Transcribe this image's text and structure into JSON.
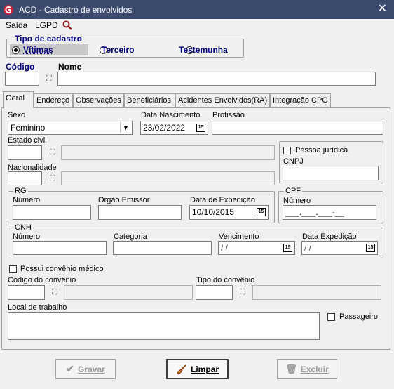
{
  "window": {
    "title": "ACD - Cadastro de envolvidos",
    "close_glyph": "✕"
  },
  "menu": {
    "items": [
      "Saída",
      "LGPD"
    ],
    "search_icon": "search-icon"
  },
  "tipo_cadastro": {
    "title": "Tipo de cadastro",
    "options": [
      "Vítimas",
      "Terceiro",
      "Testemunha"
    ],
    "selected": "Vítimas"
  },
  "header_fields": {
    "codigo_label": "Código",
    "codigo_value": "",
    "nome_label": "Nome",
    "nome_value": ""
  },
  "tabs": [
    "Geral",
    "Endereço",
    "Observações",
    "Beneficiários",
    "Acidentes Envolvidos(RA)",
    "Integração CPG"
  ],
  "active_tab": "Geral",
  "geral": {
    "sexo_label": "Sexo",
    "sexo_value": "Feminino",
    "nascimento_label": "Data Nascimento",
    "nascimento_value": "23/02/2022",
    "profissao_label": "Profissão",
    "profissao_value": "",
    "estado_civil_label": "Estado civil",
    "nacionalidade_label": "Nacionalidade",
    "pessoa_juridica_label": "Pessoa jurídica",
    "cnpj_label": "CNPJ",
    "cnpj_value": "",
    "rg": {
      "title": "RG",
      "numero_label": "Número",
      "numero_value": "",
      "orgao_label": "Orgão Emissor",
      "orgao_value": "",
      "expedicao_label": "Data de Expedição",
      "expedicao_value": "10/10/2015"
    },
    "cpf": {
      "title": "CPF",
      "numero_label": "Número",
      "numero_value": "___.___.___-__"
    },
    "cnh": {
      "title": "CNH",
      "numero_label": "Número",
      "categoria_label": "Categoria",
      "vencimento_label": "Vencimento",
      "vencimento_value": " / /",
      "expedicao_label": "Data Expedição",
      "expedicao_value": " / /"
    },
    "convenio_check_label": "Possui convênio médico",
    "codigo_convenio_label": "Código do convênio",
    "tipo_convenio_label": "Tipo do convênio",
    "local_trabalho_label": "Local de trabalho",
    "passageiro_label": "Passageiro",
    "calendar_glyph": "15"
  },
  "buttons": {
    "gravar": "Gravar",
    "limpar": "Limpar",
    "excluir": "Excluir"
  },
  "colors": {
    "titlebar": "#3c4a6e",
    "accent_label": "#000080",
    "app_icon": "#c8203a"
  }
}
